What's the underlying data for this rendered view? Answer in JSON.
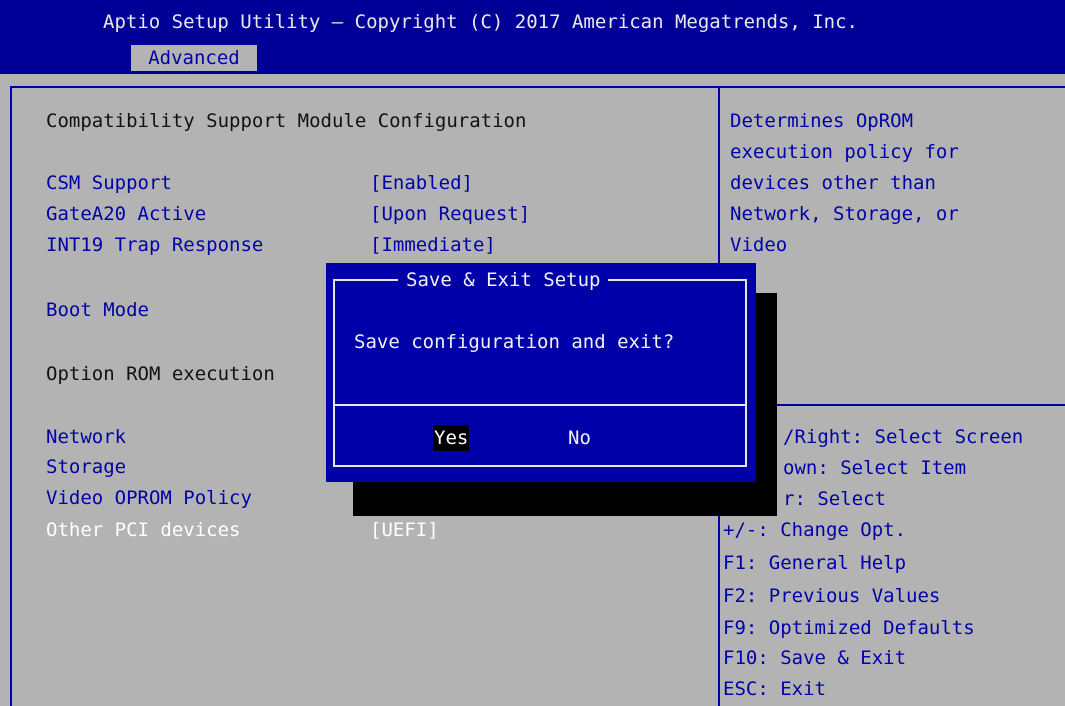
{
  "header": {
    "title": "Aptio Setup Utility – Copyright (C) 2017 American Megatrends, Inc.",
    "active_tab": "Advanced"
  },
  "main": {
    "section_title": "Compatibility Support Module Configuration",
    "csm_support": {
      "label": "CSM Support",
      "value": "[Enabled]"
    },
    "gatea20": {
      "label": "GateA20 Active",
      "value": "[Upon Request]"
    },
    "int19": {
      "label": "INT19 Trap Response",
      "value": "[Immediate]"
    },
    "boot_mode": {
      "label": "Boot Mode"
    },
    "option_rom_heading": "Option ROM execution",
    "network": {
      "label": "Network"
    },
    "storage": {
      "label": "Storage"
    },
    "video_oprom": {
      "label": "Video OPROM Policy"
    },
    "other_pci": {
      "label": "Other PCI devices",
      "value": "[UEFI]"
    }
  },
  "help": {
    "lines": [
      "Determines OpROM",
      "execution policy for",
      "devices other than",
      "Network, Storage, or",
      "Video"
    ]
  },
  "keys": {
    "lines": [
      "/Right: Select Screen",
      "own: Select Item",
      "r: Select",
      "+/-: Change Opt.",
      "F1: General Help",
      "F2: Previous Values",
      "F9: Optimized Defaults",
      "F10: Save & Exit",
      "ESC: Exit"
    ]
  },
  "dialog": {
    "title": "Save & Exit Setup",
    "message": "Save configuration and exit?",
    "yes": "Yes",
    "no": "No"
  }
}
